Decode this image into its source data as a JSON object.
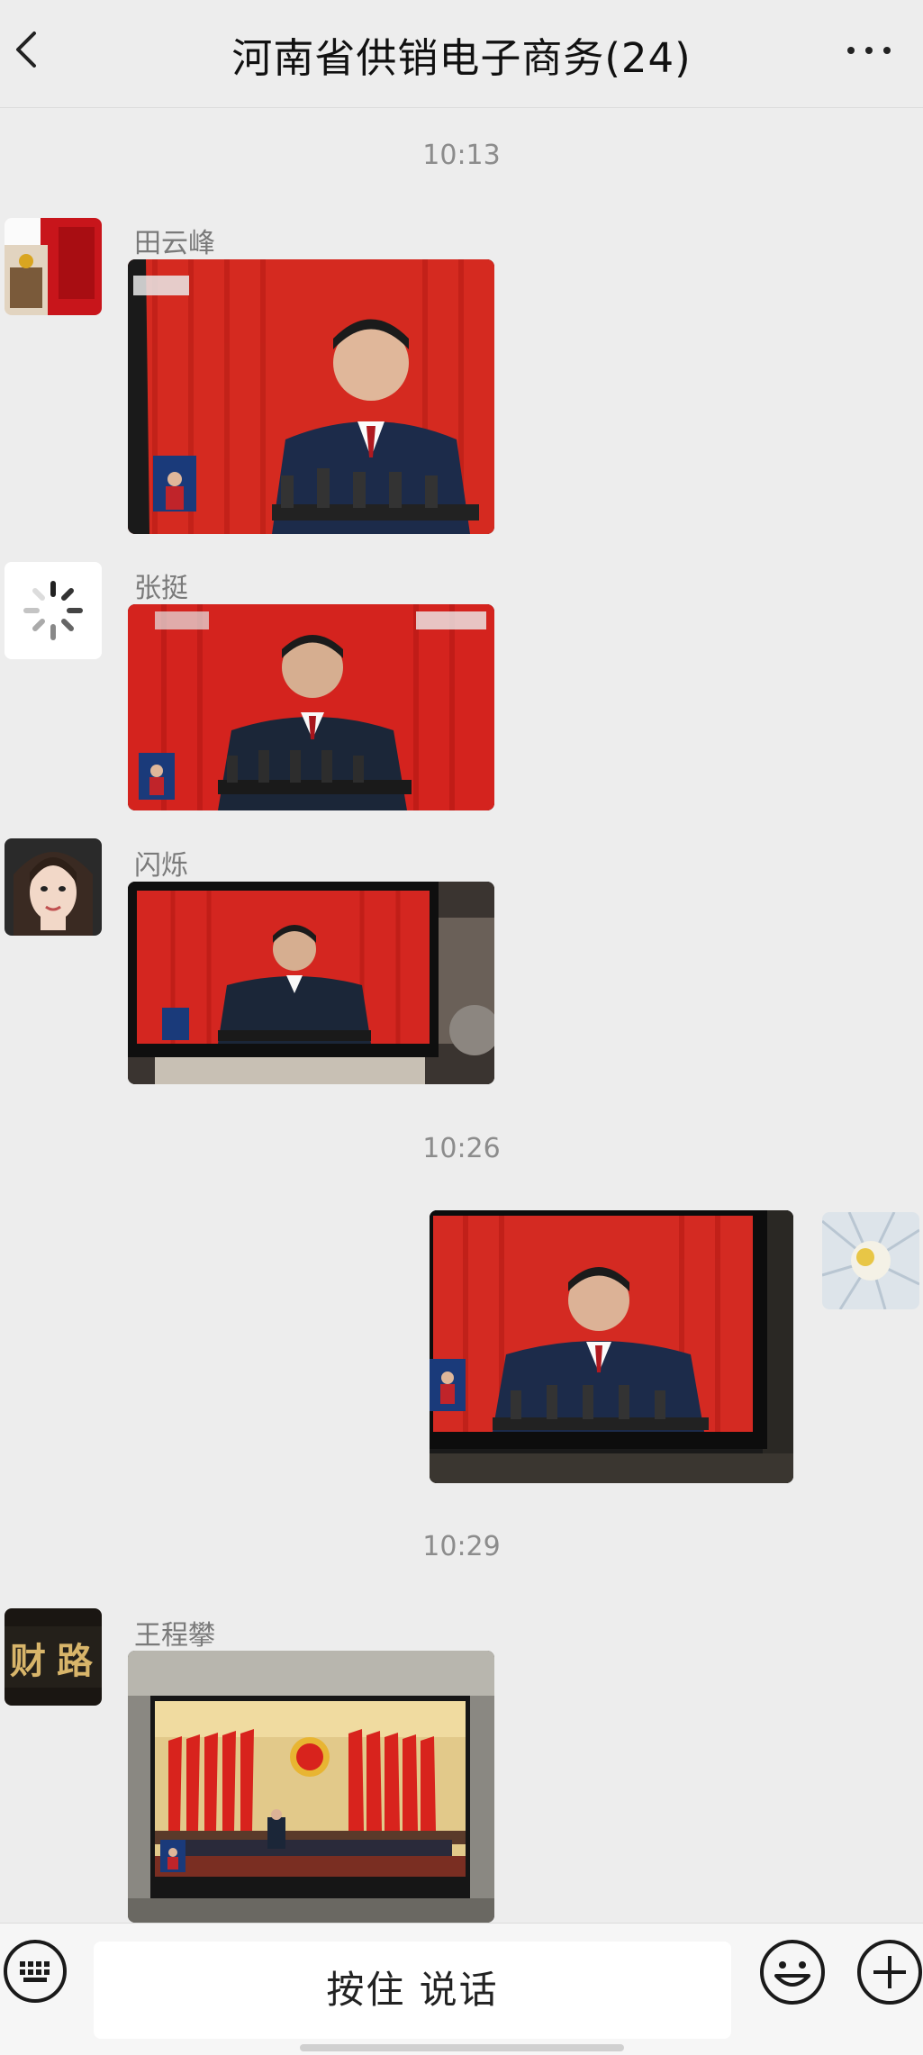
{
  "header": {
    "title": "河南省供销电子商务(24)",
    "back_icon": "chevron-left-icon",
    "more_icon": "more-horizontal-icon"
  },
  "timestamps": [
    "10:13",
    "10:26",
    "10:29"
  ],
  "messages": [
    {
      "sender": "田云峰",
      "direction": "incoming",
      "type": "image",
      "image_desc": "CCTV broadcast of speaker at podium, red curtain"
    },
    {
      "sender": "张挺",
      "direction": "incoming",
      "type": "image",
      "image_desc": "Live stream screenshot of speaker at podium, red curtain",
      "avatar_icon": "loading-spinner-icon"
    },
    {
      "sender": "闪烁",
      "direction": "incoming",
      "type": "image",
      "image_desc": "TV showing speaker at podium"
    },
    {
      "sender": "",
      "direction": "outgoing",
      "type": "image",
      "image_desc": "TV showing speaker at podium"
    },
    {
      "sender": "王程攀",
      "direction": "incoming",
      "type": "image",
      "image_desc": "TV showing congress hall with red flags and emblem",
      "avatar_text": "财 路"
    }
  ],
  "bottom_bar": {
    "voice_label": "按住 说话",
    "keyboard_icon": "keyboard-icon",
    "emoji_icon": "emoji-icon",
    "plus_icon": "plus-circle-icon"
  },
  "colors": {
    "background": "#ededed",
    "curtain_red": "#d8261f",
    "sender_gray": "#7a7a7a",
    "time_gray": "#8c8c8c"
  }
}
